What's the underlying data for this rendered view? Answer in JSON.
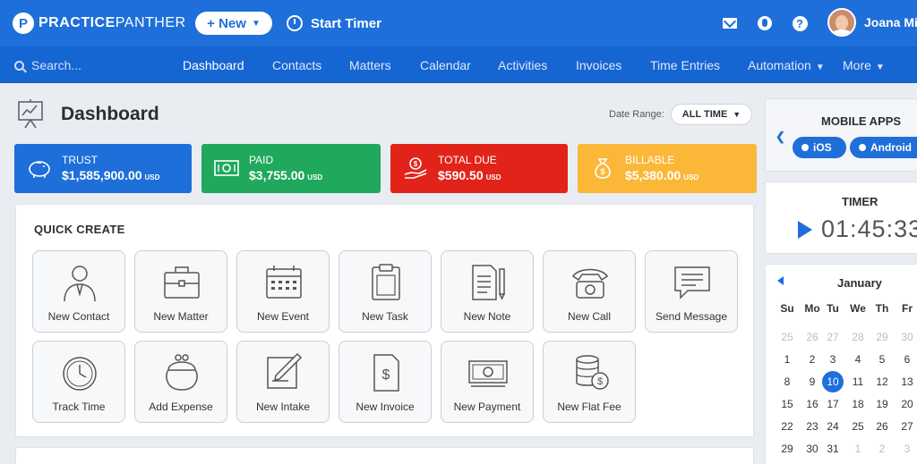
{
  "topbar": {
    "logo_bold": "PRACTICE",
    "logo_light": "PANTHER",
    "new_label": "+ New",
    "start_timer_label": "Start Timer",
    "user_name": "Joana Mi"
  },
  "nav": {
    "search_placeholder": "Search...",
    "items": [
      "Dashboard",
      "Contacts",
      "Matters",
      "Calendar",
      "Activities",
      "Invoices",
      "Time Entries",
      "Automation",
      "More"
    ]
  },
  "dashboard": {
    "title": "Dashboard",
    "date_range_label": "Date Range:",
    "date_range_value": "ALL TIME"
  },
  "stats": [
    {
      "label": "TRUST",
      "amount": "$1,585,900.00",
      "currency": "USD",
      "color": "#1e6fd9"
    },
    {
      "label": "PAID",
      "amount": "$3,755.00",
      "currency": "USD",
      "color": "#20a85c"
    },
    {
      "label": "TOTAL DUE",
      "amount": "$590.50",
      "currency": "USD",
      "color": "#e2231a"
    },
    {
      "label": "BILLABLE",
      "amount": "$5,380.00",
      "currency": "USD",
      "color": "#fbb738"
    }
  ],
  "quick_create": {
    "title": "QUICK CREATE",
    "items": [
      "New Contact",
      "New Matter",
      "New Event",
      "New Task",
      "New Note",
      "New Call",
      "Send Message",
      "Track Time",
      "Add Expense",
      "New Intake",
      "New Invoice",
      "New Payment",
      "New Flat Fee"
    ]
  },
  "mobile_apps": {
    "title": "MOBILE APPS",
    "ios": "iOS",
    "android": "Android"
  },
  "timer": {
    "title": "TIMER",
    "value": "01:45:33"
  },
  "calendar": {
    "month": "January",
    "weekdays": [
      "Su",
      "Mo",
      "Tu",
      "We",
      "Th",
      "Fr"
    ],
    "weeks": [
      [
        "25",
        "26",
        "27",
        "28",
        "29",
        "30"
      ],
      [
        "1",
        "2",
        "3",
        "4",
        "5",
        "6"
      ],
      [
        "8",
        "9",
        "10",
        "11",
        "12",
        "13"
      ],
      [
        "15",
        "16",
        "17",
        "18",
        "19",
        "20"
      ],
      [
        "22",
        "23",
        "24",
        "25",
        "26",
        "27"
      ],
      [
        "29",
        "30",
        "31",
        "1",
        "2",
        "3"
      ]
    ],
    "today": "10"
  }
}
